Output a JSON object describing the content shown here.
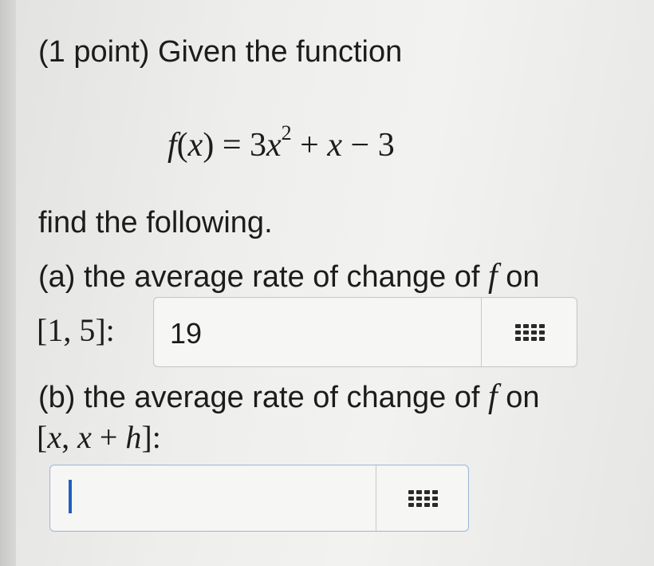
{
  "problem": {
    "title": "(1 point) Given the function",
    "formula": {
      "fn": "f",
      "arg": "x",
      "equals": "=",
      "coef": "3",
      "var": "x",
      "exp": "2",
      "plus": "+",
      "term2": "x",
      "minus": "−",
      "const": "3"
    },
    "instruction": "find the following.",
    "part_a": {
      "prompt_text": "(a) the average rate of change of",
      "prompt_var": "f",
      "prompt_end": "on",
      "interval": "[1, 5]:",
      "answer_value": "19",
      "icon": "grid-keypad-icon"
    },
    "part_b": {
      "prompt_text": "(b) the average rate of change of",
      "prompt_var": "f",
      "prompt_end": "on",
      "interval_open": "[",
      "interval_x": "x",
      "interval_sep": ", ",
      "interval_x2": "x",
      "interval_plus": " + ",
      "interval_h": "h",
      "interval_close": "]:",
      "answer_value": "",
      "icon": "grid-keypad-icon"
    }
  },
  "colors": {
    "focus_border": "#9db8d8",
    "cursor": "#1f5fc4"
  }
}
